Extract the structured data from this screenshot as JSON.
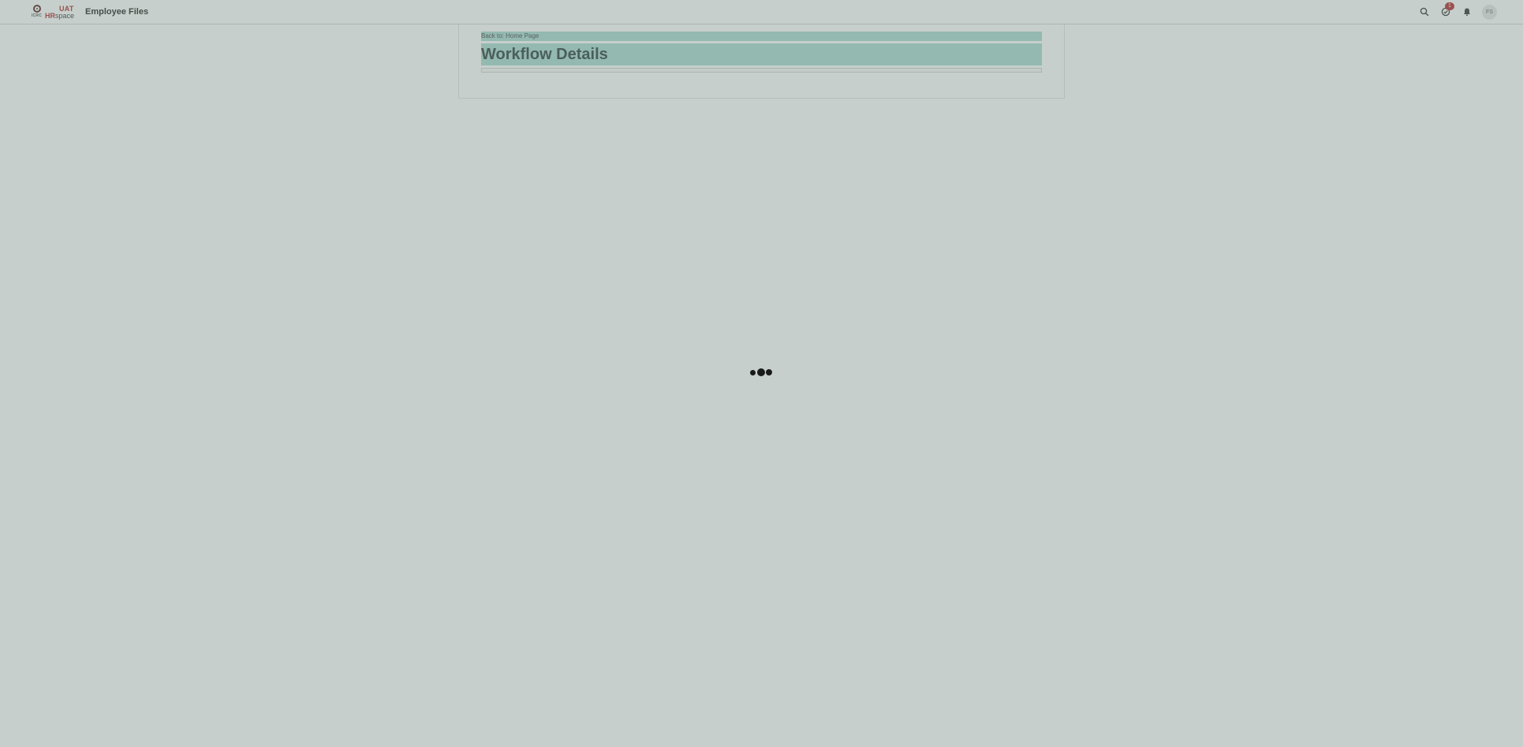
{
  "header": {
    "logo_small": "ICRC",
    "logo_env": "UAT",
    "logo_hr": "HR",
    "logo_space": "space",
    "app_title": "Employee Files",
    "tasks_badge": "1",
    "avatar_initials": "FS",
    "icons": [
      "search-icon",
      "tasks-icon",
      "bell-icon"
    ]
  },
  "main": {
    "back_link": "Back to: Home Page",
    "title": "Workflow Details"
  },
  "loading": {
    "indicator": "loading-dots"
  },
  "colors": {
    "brand_red": "#b3262b",
    "highlight": "#a9d9d3",
    "overlay": "#8fa89f"
  }
}
